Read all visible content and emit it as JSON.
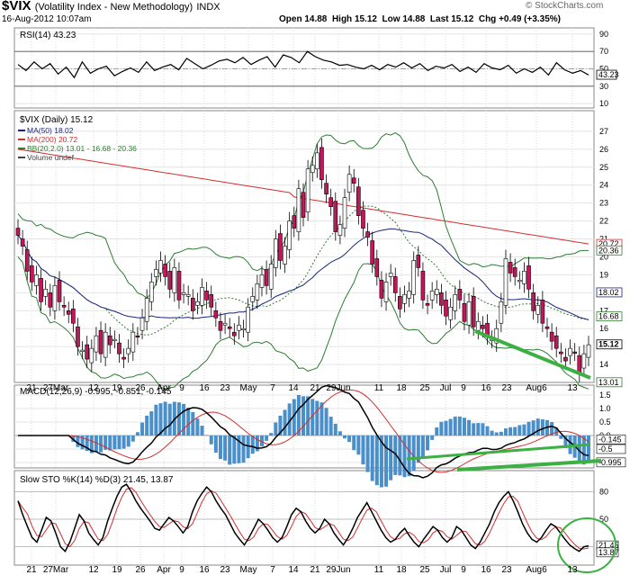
{
  "header": {
    "symbol": "$VIX",
    "name": "(Volatility Index - New Methodology)",
    "exchange": "INDX",
    "date": "16-Aug-2012 10:07am",
    "open_label": "Open",
    "open": "14.88",
    "high_label": "High",
    "high": "15.12",
    "low_label": "Low",
    "low": "14.88",
    "last_label": "Last",
    "last": "15.12",
    "chg_label": "Chg",
    "chg": "+0.49 (+3.35%)",
    "logo": "© StockCharts.com"
  },
  "chart_data": [
    {
      "type": "line",
      "panel": "rsi",
      "legend": "RSI(14) 43.23",
      "y_ticks": [
        90,
        70,
        50,
        30,
        10
      ],
      "ylim": [
        5,
        95
      ],
      "levels": [
        70,
        30
      ],
      "last_label": "43.23",
      "values": [
        55,
        48,
        58,
        50,
        56,
        44,
        52,
        40,
        58,
        45,
        50,
        53,
        42,
        47,
        51,
        46,
        58,
        48,
        52,
        55,
        49,
        62,
        56,
        50,
        54,
        59,
        61,
        57,
        63,
        55,
        60,
        64,
        52,
        66,
        63,
        57,
        70,
        64,
        60,
        58,
        54,
        55,
        52,
        50,
        54,
        49,
        55,
        52,
        57,
        51,
        56,
        48,
        53,
        51,
        55,
        47,
        52,
        46,
        56,
        51,
        49,
        54,
        45,
        50,
        46,
        52,
        43,
        57,
        49,
        45,
        48,
        43
      ]
    },
    {
      "type": "candlestick",
      "panel": "price",
      "title": "$VIX (Daily) 15.12",
      "legend": [
        "MA(50) 18.02",
        "MA(200) 20.72",
        "BB(20,2.0) 13.01 - 16.68 - 20.36",
        "Volume undef"
      ],
      "y_ticks": [
        27,
        26,
        25,
        24,
        23,
        22,
        21,
        20,
        19,
        18,
        17,
        16,
        15,
        14
      ],
      "ylim": [
        13,
        28
      ],
      "x_labels": [
        "21",
        "27Mar",
        "12",
        "19",
        "26",
        "Apr",
        "9",
        "16",
        "23",
        "May",
        "7",
        "14",
        "21",
        "29Jun",
        "11",
        "18",
        "25",
        "Jul",
        "9",
        "16",
        "23",
        "Aug6",
        "13"
      ],
      "close": [
        21.2,
        20.6,
        19.2,
        18.6,
        19.0,
        17.5,
        18.2,
        17.2,
        18.4,
        17.5,
        17.2,
        16.8,
        16.3,
        15.0,
        14.8,
        14.3,
        14.9,
        15.6,
        14.6,
        15.8,
        15.1,
        15.4,
        14.6,
        14.3,
        14.9,
        15.8,
        15.6,
        16.6,
        17.7,
        18.6,
        19.3,
        19.8,
        18.9,
        18.2,
        19.4,
        17.6,
        18.0,
        17.9,
        17.0,
        17.5,
        18.3,
        17.6,
        17.2,
        16.6,
        15.9,
        16.3,
        16.0,
        15.6,
        16.2,
        16.0,
        17.2,
        17.8,
        18.5,
        19.0,
        18.4,
        19.6,
        21.0,
        19.8,
        20.6,
        22.0,
        21.6,
        23.8,
        22.2,
        24.9,
        25.1,
        25.8,
        24.3,
        23.5,
        22.8,
        21.4,
        21.8,
        23.3,
        24.6,
        24.1,
        22.3,
        21.6,
        21.1,
        19.6,
        18.9,
        17.7,
        18.6,
        19.1,
        18.0,
        17.1,
        17.9,
        18.1,
        19.8,
        19.4,
        17.6,
        17.3,
        18.1,
        18.2,
        17.3,
        16.7,
        17.2,
        17.9,
        17.6,
        16.4,
        17.5,
        16.1,
        16.4,
        16.0,
        15.6,
        15.4,
        16.0,
        17.5,
        19.9,
        19.1,
        18.9,
        18.7,
        19.2,
        18.2,
        17.0,
        17.3,
        16.3,
        16.0,
        15.3,
        14.9,
        14.6,
        14.2,
        14.9,
        14.7,
        13.5,
        14.6,
        15.1
      ],
      "ma50_last": "18.02",
      "ma200_last": "20.72",
      "bb_last": [
        "20.36",
        "16.68",
        "13.01"
      ],
      "price_last": "15.12"
    },
    {
      "type": "macd",
      "panel": "macd",
      "legend": "MACD(12,26,9) -0.995, -0.851, -0.145",
      "y_ticks": [
        "1.5",
        "1.0",
        "0.5",
        "0.0",
        "-0.5",
        "-1.0"
      ],
      "last_labels": [
        "-0.145",
        "-0.5",
        "-0.995"
      ]
    },
    {
      "type": "stochastic",
      "panel": "sto",
      "legend": "Slow STO %K(14) %D(3) 21.45, 13.87",
      "y_ticks": [
        80,
        50,
        20
      ],
      "last_labels": [
        "21.45",
        "13.87"
      ],
      "k_values": [
        70,
        55,
        42,
        30,
        25,
        38,
        52,
        48,
        35,
        20,
        15,
        25,
        40,
        55,
        48,
        35,
        28,
        22,
        30,
        48,
        62,
        75,
        85,
        88,
        80,
        70,
        62,
        55,
        48,
        40,
        38,
        45,
        52,
        48,
        42,
        35,
        42,
        58,
        70,
        78,
        85,
        80,
        70,
        62,
        55,
        45,
        35,
        28,
        22,
        30,
        40,
        50,
        45,
        38,
        30,
        25,
        30,
        42,
        55,
        62,
        58,
        48,
        40,
        35,
        40,
        50,
        45,
        35,
        28,
        22,
        30,
        40,
        52,
        60,
        68,
        58,
        48,
        38,
        30,
        25,
        28,
        35,
        40,
        32,
        25,
        20,
        28,
        35,
        42,
        38,
        30,
        25,
        30,
        42,
        38,
        30,
        22,
        18,
        25,
        35,
        45,
        58,
        68,
        75,
        80,
        70,
        58,
        45,
        35,
        28,
        25,
        30,
        38,
        45,
        42,
        35,
        28,
        22,
        18,
        15,
        20,
        21
      ]
    }
  ]
}
